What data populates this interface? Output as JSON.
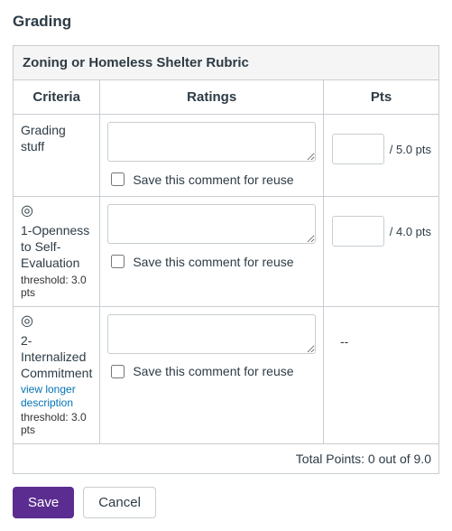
{
  "section_title": "Grading",
  "rubric_title": "Zoning or Homeless Shelter Rubric",
  "headers": {
    "criteria": "Criteria",
    "ratings": "Ratings",
    "pts": "Pts"
  },
  "reuse_label": "Save this comment for reuse",
  "rows": [
    {
      "name": "Grading stuff",
      "has_target": false,
      "threshold": "",
      "view_longer": "",
      "pts_suffix": "/ 5.0 pts",
      "show_input": true
    },
    {
      "name": "1-Openness to Self-Evaluation",
      "has_target": true,
      "threshold": "threshold: 3.0 pts",
      "view_longer": "",
      "pts_suffix": "/ 4.0 pts",
      "show_input": true
    },
    {
      "name": "2-Internalized Commitment",
      "has_target": true,
      "threshold": "threshold: 3.0 pts",
      "view_longer": "view longer description",
      "pts_suffix": "--",
      "show_input": false
    }
  ],
  "total_label": "Total Points: 0 out of 9.0",
  "buttons": {
    "save": "Save",
    "cancel": "Cancel"
  }
}
